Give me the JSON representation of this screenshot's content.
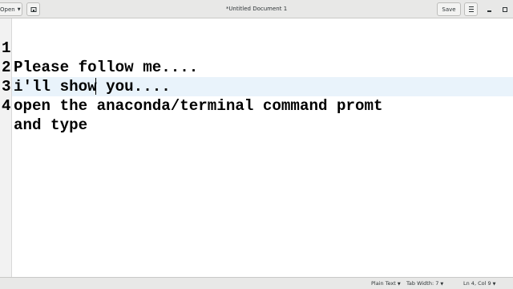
{
  "header": {
    "open_label": "Open",
    "title": "*Untitled Document 1",
    "save_label": "Save"
  },
  "editor": {
    "lines": [
      {
        "number": "1",
        "text": "Please follow me...."
      },
      {
        "number": "2",
        "text": "i'll show you...."
      },
      {
        "number": "3",
        "text": "open the anaconda/terminal command promt"
      },
      {
        "number": "4",
        "text": "and type"
      }
    ],
    "current_line": 4
  },
  "status": {
    "language": "Plain Text",
    "tab_width": "Tab Width: 7",
    "position": "Ln 4, Col 9"
  },
  "colors": {
    "headerbar_bg": "#e8e8e7",
    "current_line_bg": "#e9f3fb",
    "gutter_bg": "#f2f2f2",
    "text": "#000000"
  },
  "icons": {
    "new_tab": "new-tab-icon",
    "menu": "hamburger-menu-icon",
    "minimize": "minimize-icon",
    "maximize": "maximize-icon",
    "dropdown": "chevron-down-icon"
  }
}
